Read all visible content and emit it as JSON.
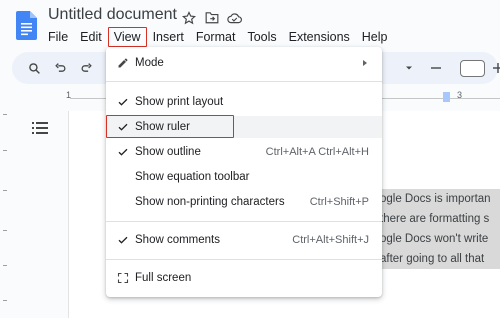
{
  "document": {
    "title": "Untitled document"
  },
  "menubar": {
    "items": [
      {
        "label": "File"
      },
      {
        "label": "Edit"
      },
      {
        "label": "View"
      },
      {
        "label": "Insert"
      },
      {
        "label": "Format"
      },
      {
        "label": "Tools"
      },
      {
        "label": "Extensions"
      },
      {
        "label": "Help"
      }
    ]
  },
  "ruler": {
    "left_number": "1",
    "right_number": "3"
  },
  "view_menu": {
    "mode": {
      "label": "Mode"
    },
    "print_layout": {
      "label": "Show print layout",
      "checked": true
    },
    "ruler": {
      "label": "Show ruler",
      "checked": true
    },
    "outline": {
      "label": "Show outline",
      "shortcut": "Ctrl+Alt+A Ctrl+Alt+H",
      "checked": true
    },
    "equation_toolbar": {
      "label": "Show equation toolbar"
    },
    "non_printing": {
      "label": "Show non-printing characters",
      "shortcut": "Ctrl+Shift+P"
    },
    "comments": {
      "label": "Show comments",
      "shortcut": "Ctrl+Alt+Shift+J",
      "checked": true
    },
    "full_screen": {
      "label": "Full screen"
    }
  },
  "page_text": {
    "lines": [
      "ogle Docs is importan",
      " there are formatting s",
      "ogle Docs won't write",
      " after going to all that"
    ]
  },
  "colors": {
    "accent_highlight": "#d93025",
    "doc_blue": "#4285f4"
  },
  "icons": [
    "docs-logo-icon",
    "star-icon",
    "move-folder-icon",
    "cloud-saved-icon",
    "search-icon",
    "undo-icon",
    "redo-icon",
    "pencil-icon",
    "check-icon",
    "fullscreen-icon",
    "outline-icon"
  ]
}
